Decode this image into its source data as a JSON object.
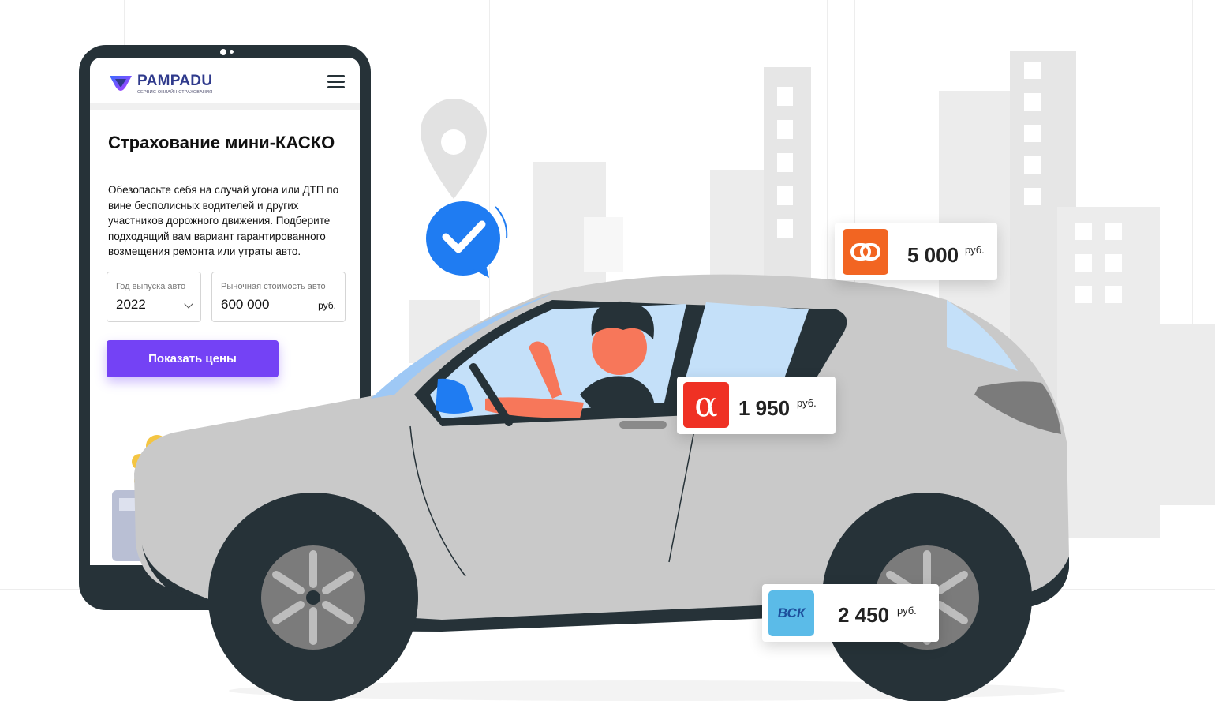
{
  "app": {
    "brand": "PAMPADU",
    "brand_tagline": "СЕРВИС ОНЛАЙН СТРАХОВАНИЯ"
  },
  "hero": {
    "title": "Страхование мини-КАСКО",
    "description": "Обезопасьте себя на случай угона или ДТП по вине бесполисных водителей и других участников дорожного движения. Подберите подходящий вам вариант гарантированного возмещения ремонта или утраты авто."
  },
  "form": {
    "year": {
      "label": "Год выпуска авто",
      "value": "2022"
    },
    "price": {
      "label": "Рыночная стоимость авто",
      "value": "600 000",
      "unit": "руб."
    },
    "submit_label": "Показать цены"
  },
  "offers": [
    {
      "insurer_icon": "link-rings-logo",
      "amount": "5 000",
      "currency": "руб.",
      "color": "#f26522"
    },
    {
      "insurer_icon": "alfa-logo",
      "amount": "1 950",
      "currency": "руб.",
      "color": "#ef3124",
      "logo_text": "α"
    },
    {
      "insurer_icon": "vsk-logo",
      "amount": "2 450",
      "currency": "руб.",
      "color": "#5bbbe8",
      "logo_text": "ВСК"
    }
  ],
  "colors": {
    "accent": "#7442f5",
    "brand_blue": "#2f3a8c",
    "check_badge": "#1f7cf2",
    "car_body": "#c9c9c9",
    "building": "#ececec"
  }
}
